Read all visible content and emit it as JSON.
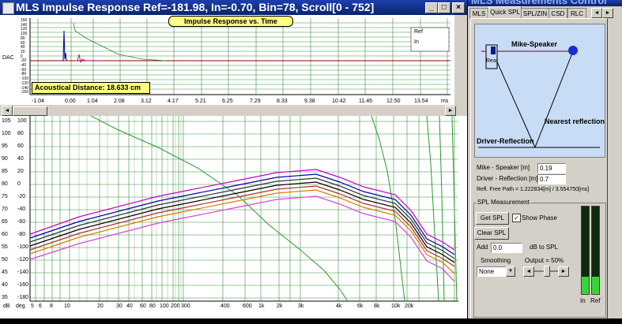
{
  "left_window": {
    "title": "MLS Impulse Response  Ref=-181.98, In=-0.70, Bin=78, Scroll[0 - 752]",
    "impulse": {
      "title": "Impulse Response vs. Time",
      "acoustic_distance": "Acoustical Distance: 18.633 cm",
      "y_label": "DAC",
      "y_ticks": [
        "160",
        "140",
        "120",
        "100",
        "80",
        "60",
        "40",
        "20",
        "0",
        "-20",
        "-40",
        "-60",
        "-80",
        "-100",
        "-120",
        "-140",
        "-160"
      ],
      "x_ticks": [
        "-1.04",
        "0.00",
        "1.04",
        "2.08",
        "3.12",
        "4.17",
        "5.21",
        "6.25",
        "7.29",
        "8.33",
        "9.38",
        "10.42",
        "11.46",
        "12.50",
        "13.54"
      ],
      "x_unit": "ms",
      "legend": [
        "Ref",
        "In"
      ]
    },
    "freq": {
      "y_ticks_db": [
        "105",
        "100",
        "95",
        "90",
        "85",
        "80",
        "75",
        "70",
        "65",
        "60",
        "55",
        "50",
        "45",
        "40",
        "35"
      ],
      "y_ticks_deg": [
        "100",
        "80",
        "60",
        "40",
        "20",
        "0",
        "-20",
        "-40",
        "-60",
        "-80",
        "-100",
        "-120",
        "-140",
        "-160",
        "-180"
      ],
      "x_unit_db": "dB",
      "x_unit_deg": "deg",
      "x_ticks": [
        "5",
        "6",
        "8",
        "10",
        "20",
        "30",
        "40",
        "60",
        "80",
        "100",
        "200",
        "300",
        "400",
        "600",
        "1k",
        "2k",
        "3k",
        "4k",
        "6k",
        "8k",
        "10k",
        "20k"
      ]
    }
  },
  "right_window": {
    "title": "MLS Measurements Control",
    "tabs": [
      "MLS",
      "Quick SPL",
      "SPL/ZIN",
      "CSD",
      "RLC"
    ],
    "diagram": {
      "mike_speaker": "Mike-Speaker",
      "rear": "Rear",
      "nearest": "Nearest reflection",
      "driver_reflection": "Driver-Reflection"
    },
    "mike_speaker_label": "Mike - Speaker [m]",
    "mike_speaker_value": "0.19",
    "driver_reflection_label": "Driver - Reflection [m]",
    "driver_reflection_value": "0.7",
    "free_path": "Refl. Free Path = 1.222834[m] / 3.554750[ms]",
    "spl_group": "SPL Measurement",
    "get_spl": "Get SPL",
    "show_phase": "Show Phase",
    "clear_spl": "Clear SPL",
    "add_label": "Add",
    "add_value": "0.0",
    "db_to_spl": "dB to SPL",
    "smoothing_label": "Smoothing",
    "smoothing_value": "None",
    "output_label": "Output = 50%",
    "meter_in": "In",
    "meter_ref": "Ref"
  }
}
